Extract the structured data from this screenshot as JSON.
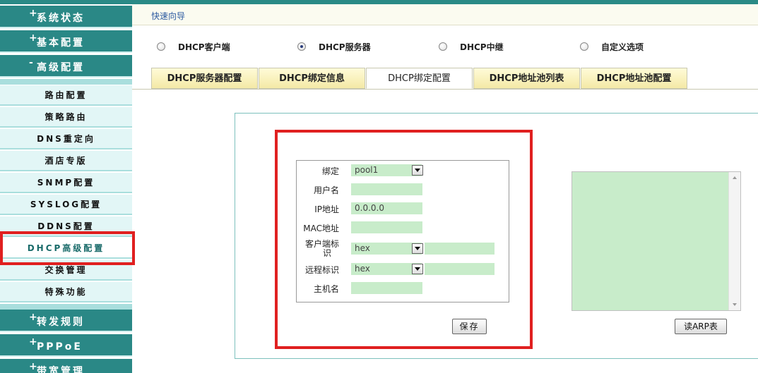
{
  "sidebar": {
    "categories": [
      {
        "symbol": "+",
        "label": "系统状态"
      },
      {
        "symbol": "+",
        "label": "基本配置"
      },
      {
        "symbol": "-",
        "label": "高级配置"
      },
      {
        "symbol": "+",
        "label": "转发规则"
      },
      {
        "symbol": "+",
        "label": "PPPoE"
      },
      {
        "symbol": "+",
        "label": "带宽管理"
      }
    ],
    "items": [
      {
        "label": "路由配置"
      },
      {
        "label": "策略路由"
      },
      {
        "label": "DNS重定向"
      },
      {
        "label": "酒店专版"
      },
      {
        "label": "SNMP配置"
      },
      {
        "label": "SYSLOG配置"
      },
      {
        "label": "DDNS配置"
      },
      {
        "label": "DHCP高级配置"
      },
      {
        "label": "交换管理"
      },
      {
        "label": "特殊功能"
      }
    ]
  },
  "breadcrumb": {
    "label": "快速向导"
  },
  "modes": [
    {
      "label": "DHCP客户端",
      "selected": false
    },
    {
      "label": "DHCP服务器",
      "selected": true
    },
    {
      "label": "DHCP中继",
      "selected": false
    },
    {
      "label": "自定义选项",
      "selected": false
    }
  ],
  "tabs": [
    {
      "label": "DHCP服务器配置",
      "active": false
    },
    {
      "label": "DHCP绑定信息",
      "active": false
    },
    {
      "label": "DHCP绑定配置",
      "active": true
    },
    {
      "label": "DHCP地址池列表",
      "active": false
    },
    {
      "label": "DHCP地址池配置",
      "active": false
    }
  ],
  "form": {
    "bind_label": "绑定",
    "bind_value": "pool1",
    "username_label": "用户名",
    "username_value": "",
    "ip_label": "IP地址",
    "ip_value": "0.0.0.0",
    "mac_label": "MAC地址",
    "mac_value": "",
    "client_id_label_1": "客户端标",
    "client_id_label_2": "识",
    "client_id_type": "hex",
    "client_id_value": "",
    "remote_id_label": "远程标识",
    "remote_id_type": "hex",
    "remote_id_value": "",
    "hostname_label": "主机名",
    "hostname_value": "",
    "save_button": "保存"
  },
  "arp": {
    "read_button": "读ARP表"
  },
  "colors": {
    "sidebar_teal": "#2a8886",
    "input_green": "#c8ecca",
    "highlight_red": "#e02020",
    "tab_yellow": "#f4e9a6"
  }
}
